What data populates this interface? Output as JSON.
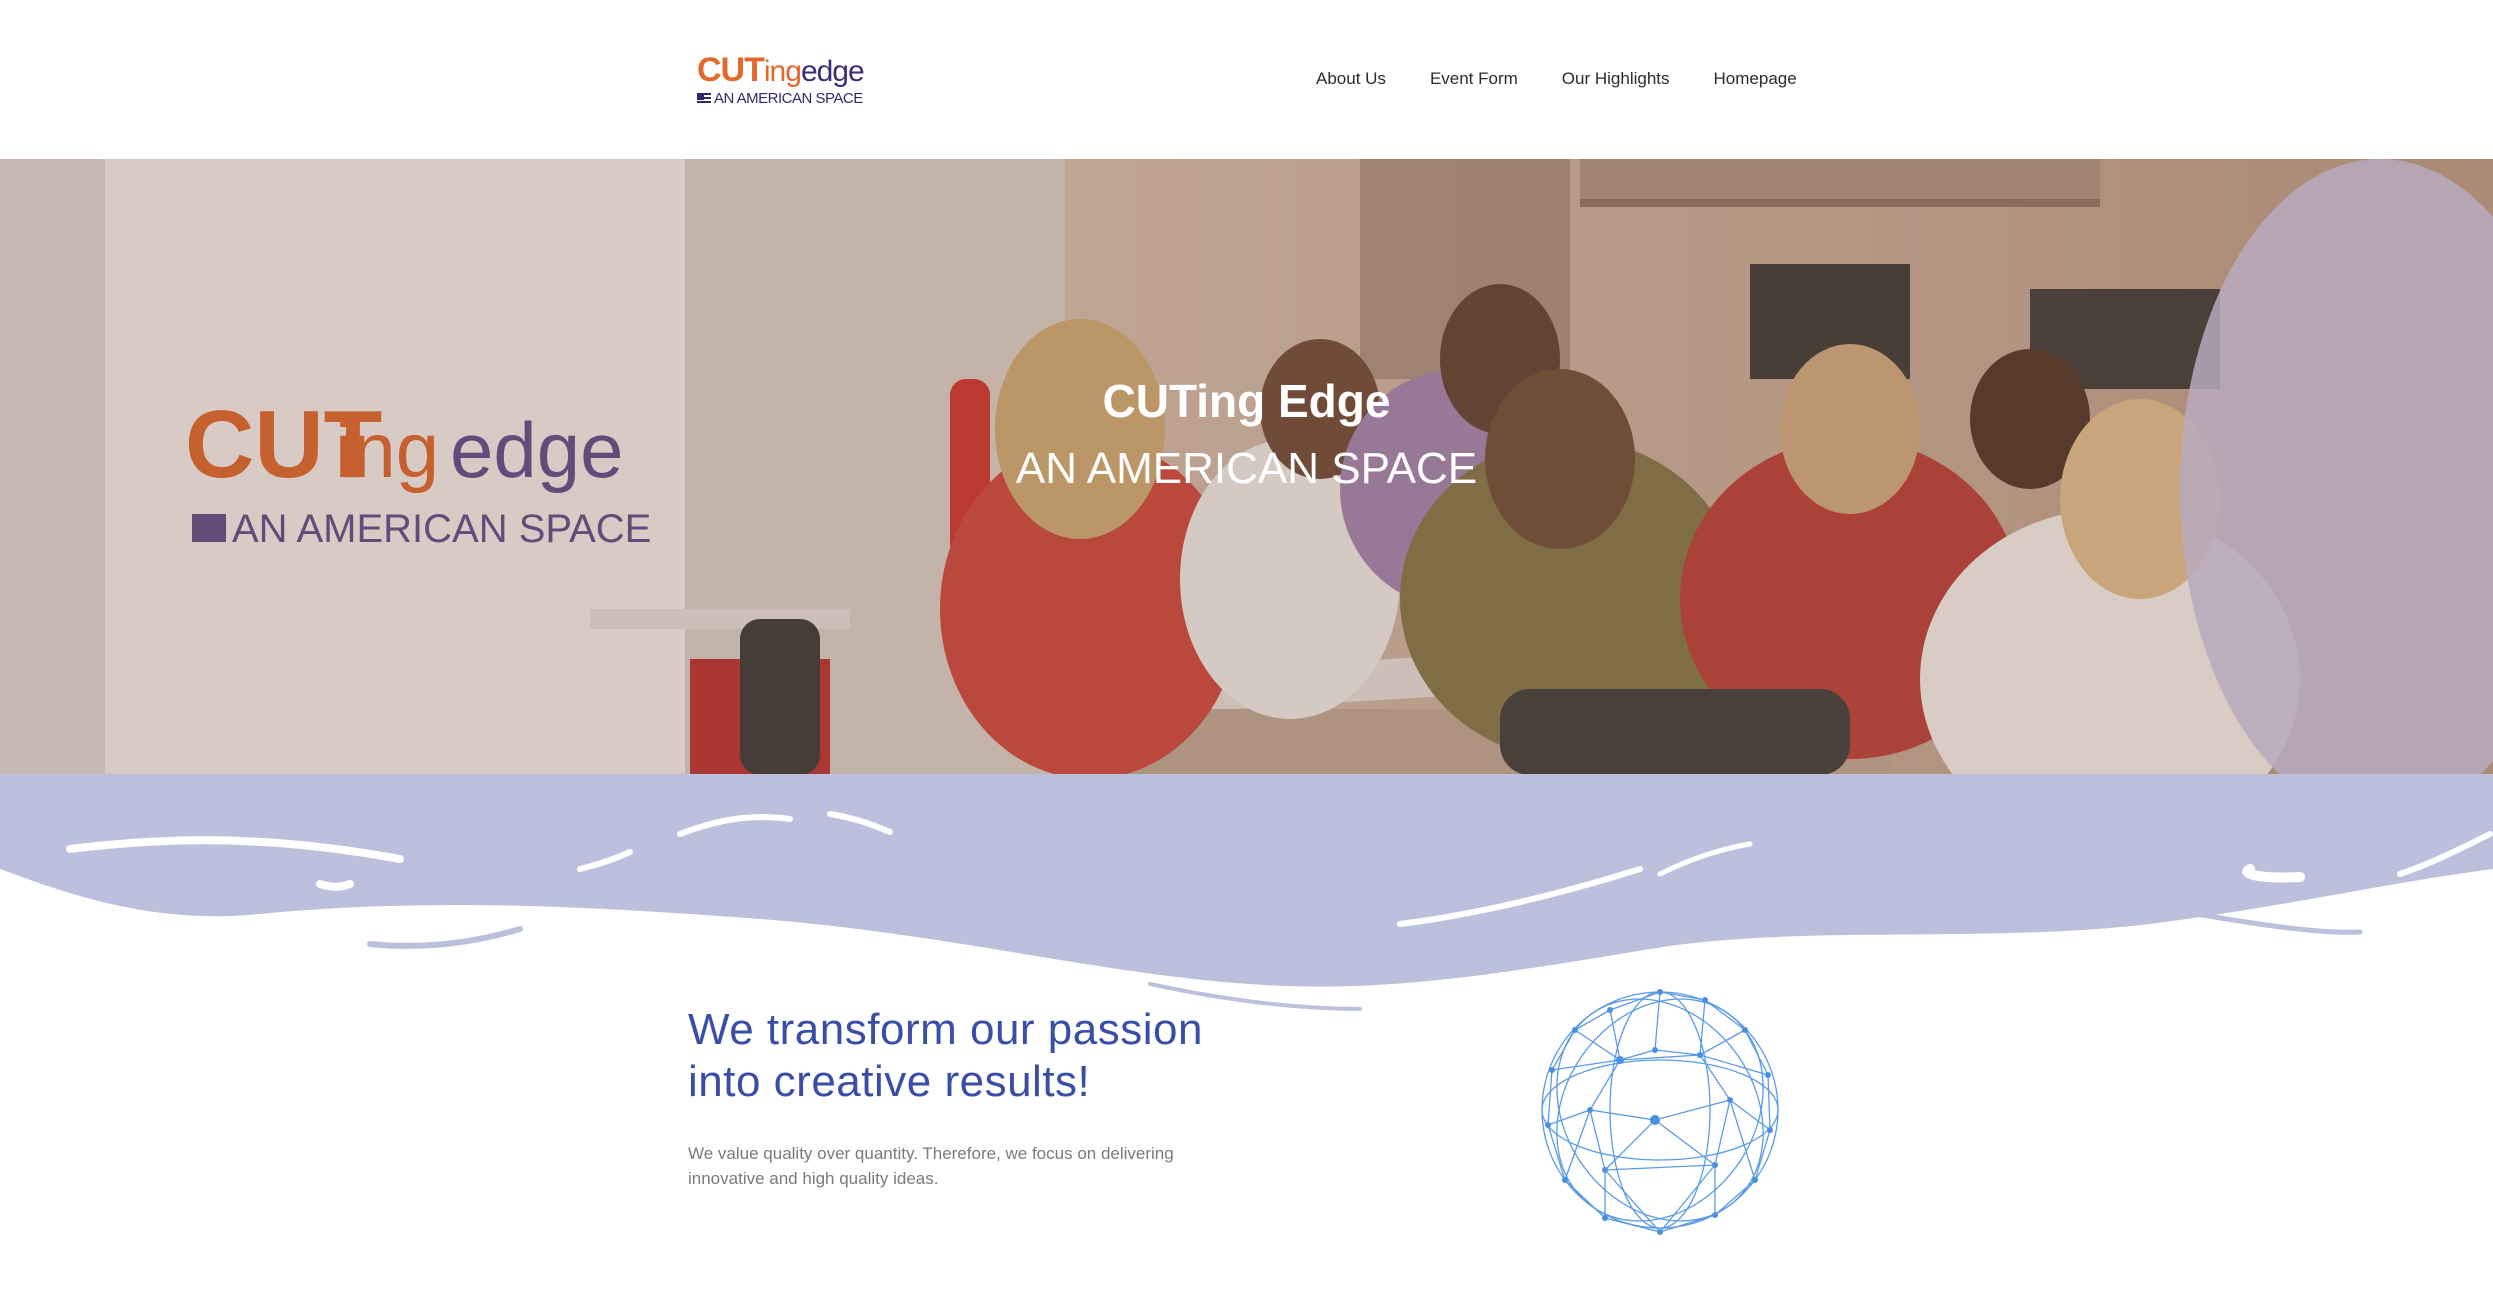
{
  "header": {
    "logo": {
      "part1": "CUT",
      "part2": "ing",
      "part3": "edge",
      "subtitle": "AN AMERICAN SPACE",
      "colors": {
        "orange": "#e2692b",
        "purple": "#3b2f78",
        "navy": "#2f2a6a"
      }
    },
    "nav": [
      {
        "label": "About Us"
      },
      {
        "label": "Event Form"
      },
      {
        "label": "Our Highlights"
      },
      {
        "label": "Homepage"
      }
    ]
  },
  "hero": {
    "title": "CUTing Edge",
    "subtitle": "AN AMERICAN SPACE",
    "image": "photo-of-people-working-at-tables",
    "banner_logo": {
      "part1": "CUT",
      "part2": "ing",
      "part3": "edge",
      "subtitle": "AN AMERICAN SPACE"
    }
  },
  "colors": {
    "wave": "#bdc0dc",
    "headline": "#3a4ea8",
    "body": "#7a7a7a",
    "globe": "#4a90e2"
  },
  "intro": {
    "headline_line1": "We transform our passion",
    "headline_line2": "into creative results!",
    "body_line1": "We value quality over quantity. Therefore, we focus on delivering",
    "body_line2": "innovative and high quality ideas.",
    "illustration": "network-globe-icon"
  }
}
